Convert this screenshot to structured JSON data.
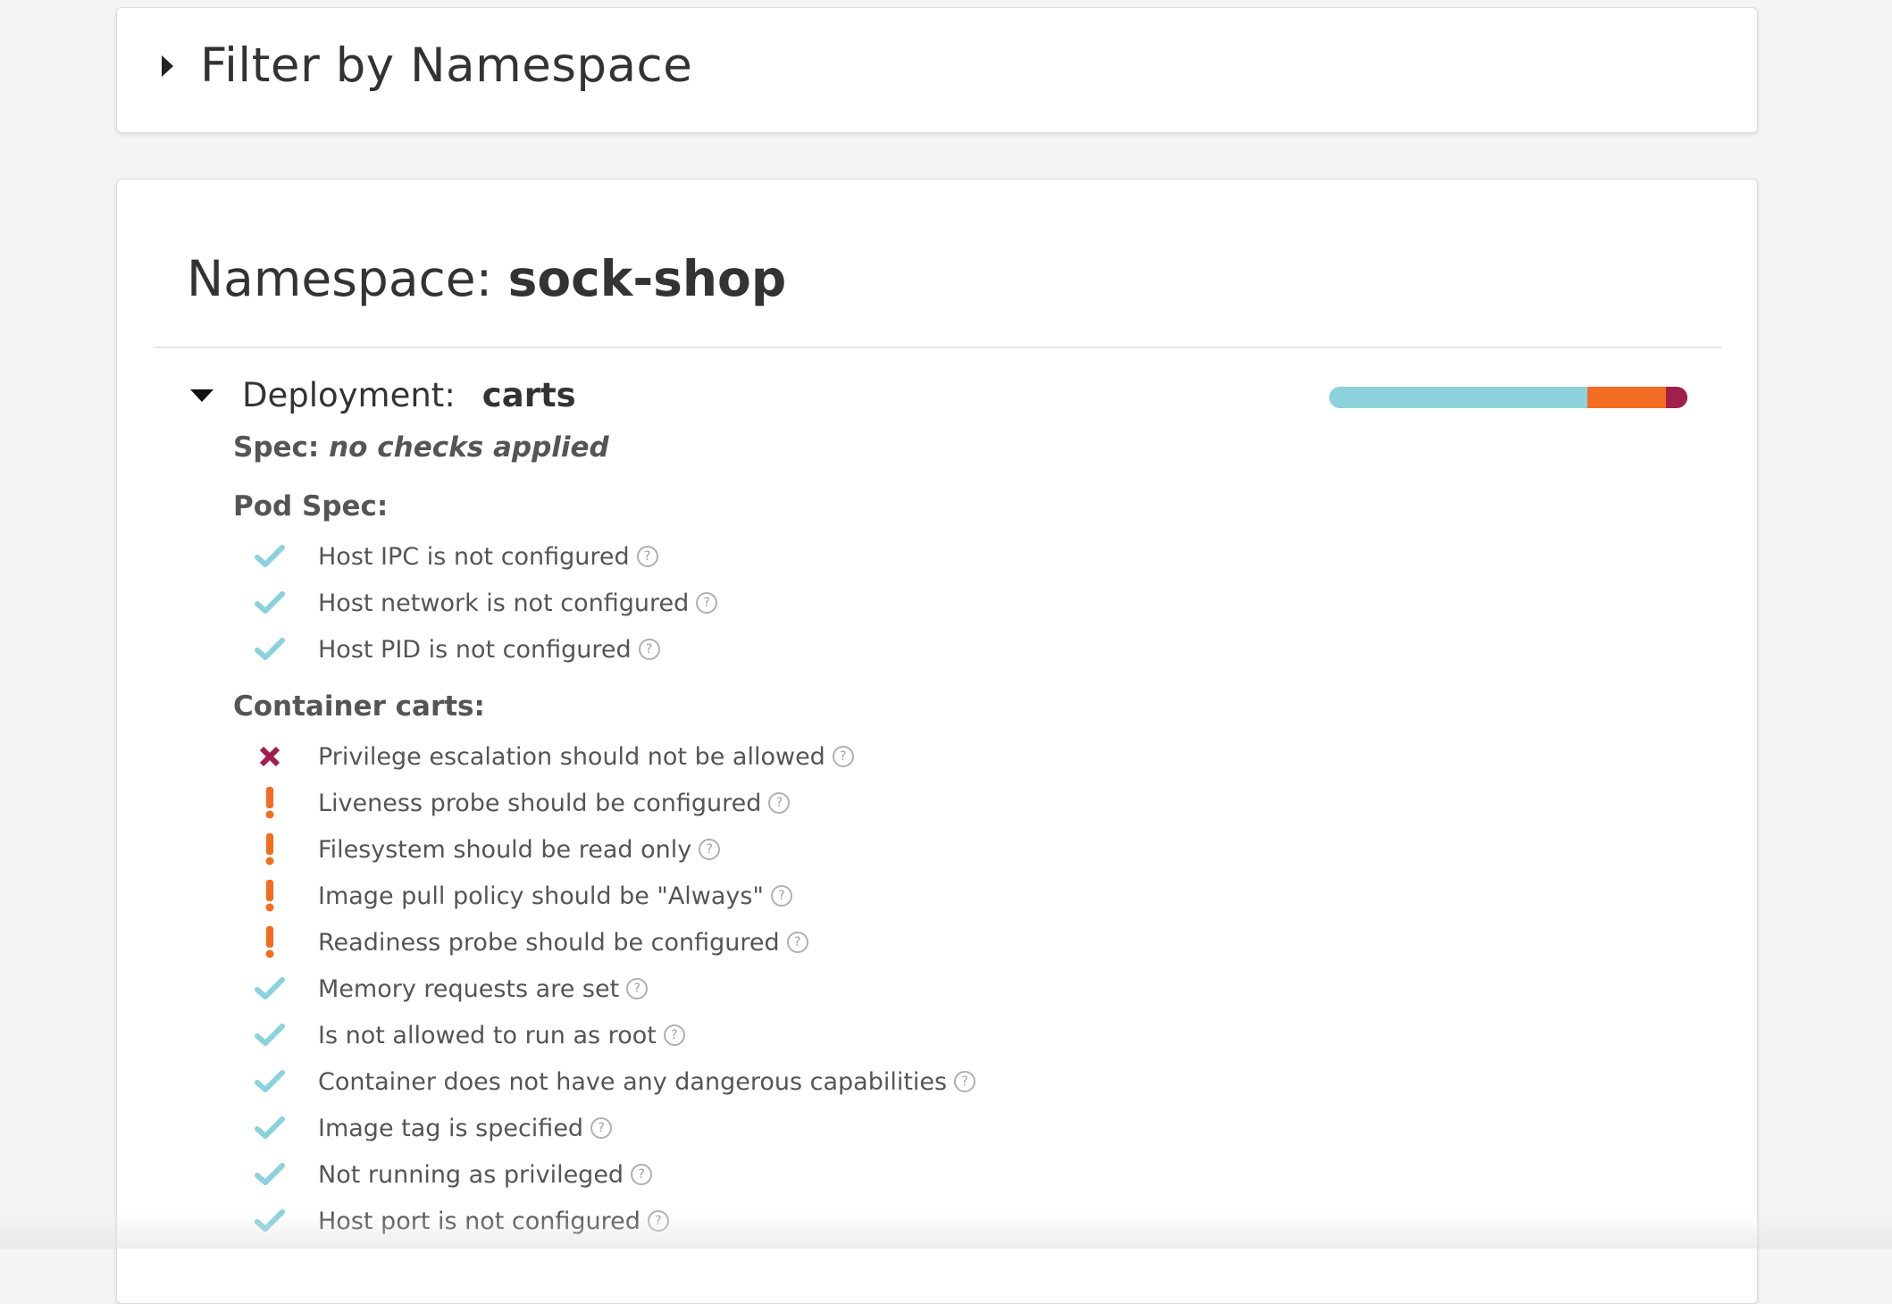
{
  "filter": {
    "title": "Filter by Namespace"
  },
  "namespace": {
    "label": "Namespace: ",
    "name": "sock-shop"
  },
  "deployment": {
    "label": "Deployment:",
    "name": "carts",
    "score": {
      "success_fraction": 0.72,
      "warning_fraction": 0.22,
      "error_fraction": 0.06
    }
  },
  "spec": {
    "label": "Spec: ",
    "value": "no checks applied"
  },
  "pod_spec": {
    "title": "Pod Spec:",
    "checks": [
      {
        "status": "success",
        "text": "Host IPC is not configured"
      },
      {
        "status": "success",
        "text": "Host network is not configured"
      },
      {
        "status": "success",
        "text": "Host PID is not configured"
      }
    ]
  },
  "container": {
    "title": "Container carts:",
    "checks": [
      {
        "status": "error",
        "text": "Privilege escalation should not be allowed"
      },
      {
        "status": "warning",
        "text": "Liveness probe should be configured"
      },
      {
        "status": "warning",
        "text": "Filesystem should be read only"
      },
      {
        "status": "warning",
        "text": "Image pull policy should be \"Always\""
      },
      {
        "status": "warning",
        "text": "Readiness probe should be configured"
      },
      {
        "status": "success",
        "text": "Memory requests are set"
      },
      {
        "status": "success",
        "text": "Is not allowed to run as root"
      },
      {
        "status": "success",
        "text": "Container does not have any dangerous capabilities"
      },
      {
        "status": "success",
        "text": "Image tag is specified"
      },
      {
        "status": "success",
        "text": "Not running as privileged"
      },
      {
        "status": "success",
        "text": "Host port is not configured"
      }
    ]
  },
  "help_glyph": "?",
  "colors": {
    "success": "#8BD2DC",
    "warning": "#F26C21",
    "error": "#A11F4C"
  },
  "icons": {
    "success": "checkmark-icon",
    "warning": "exclamation-icon",
    "error": "x-mark-icon",
    "help": "question-circle-icon",
    "collapsed": "caret-right-icon",
    "expanded": "caret-down-icon"
  }
}
